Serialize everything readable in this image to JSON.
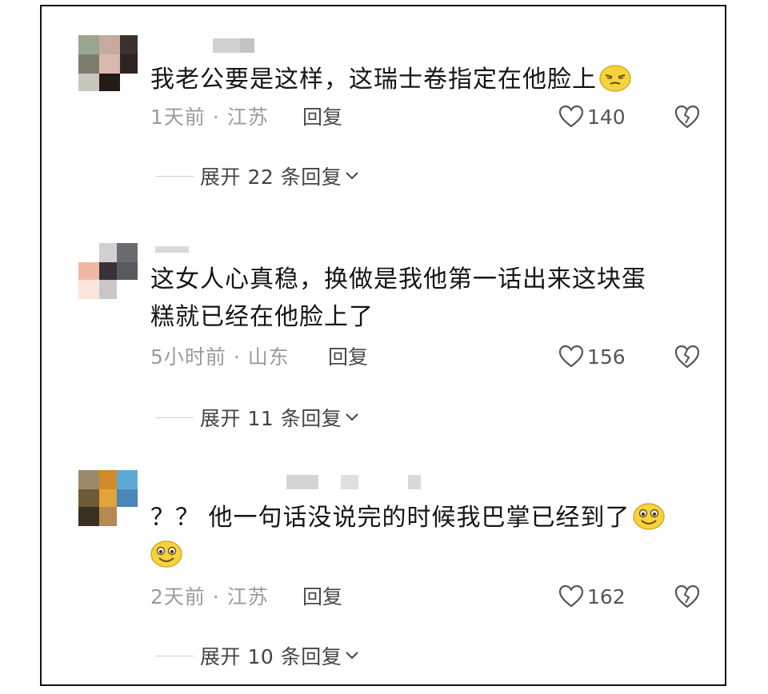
{
  "comments": [
    {
      "text": "我老公要是这样，这瑞士卷指定在他脸上",
      "emoji": "smirk-emoji",
      "time": "1天前 · 江苏",
      "reply": "回复",
      "likes": "140",
      "expand": "展开 22 条回复"
    },
    {
      "text_line1": "这女人心真稳，换做是我他第一话出来这块蛋",
      "text_line2": "糕就已经在他脸上了",
      "time": "5小时前 · 山东",
      "reply": "回复",
      "likes": "156",
      "expand": "展开 11 条回复"
    },
    {
      "text": "？？ 他一句话没说完的时候我巴掌已经到了",
      "emoji": "grin-emoji",
      "time": "2天前 · 江苏",
      "reply": "回复",
      "likes": "162",
      "expand": "展开 10 条回复"
    }
  ],
  "colors": {
    "meta": "#9b9b9b",
    "text": "#151515",
    "emoji": "#f5d33c"
  }
}
